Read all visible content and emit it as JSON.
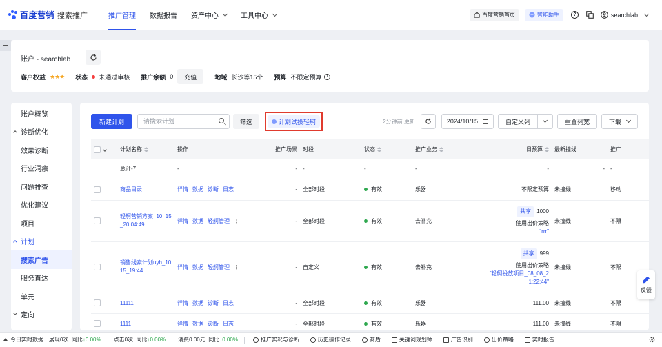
{
  "topbar": {
    "brand": "百度营销",
    "product": "搜索推广",
    "nav": [
      {
        "label": "推广管理",
        "active": true,
        "dropdown": false
      },
      {
        "label": "数据报告",
        "active": false,
        "dropdown": false
      },
      {
        "label": "资产中心",
        "active": false,
        "dropdown": true
      },
      {
        "label": "工具中心",
        "active": false,
        "dropdown": true
      }
    ],
    "home_label": "百度营销首页",
    "assistant_label": "智能助手",
    "help_icon": "question-icon",
    "copy_icon": "copy-icon",
    "username": "searchlab",
    "accent_color": "#2f54eb"
  },
  "account": {
    "title": "账户 - searchlab",
    "rating_label": "客户权益",
    "rating_stars": 3,
    "status_label": "状态",
    "status_value": "未通过审核",
    "status_color": "#f53f3f",
    "balance_label": "推广余额",
    "balance_value": "0",
    "charge_button": "充值",
    "region_label": "地域",
    "region_value": "长沙等15个",
    "budget_label": "预算",
    "budget_value": "不限定预算"
  },
  "sidebar": {
    "items": [
      {
        "label": "账户概览",
        "type": "item",
        "selected": false
      },
      {
        "label": "诊断优化",
        "type": "group",
        "open": false
      },
      {
        "label": "效果诊断",
        "type": "item",
        "selected": false
      },
      {
        "label": "行业洞察",
        "type": "item",
        "selected": false
      },
      {
        "label": "问题排查",
        "type": "item",
        "selected": false
      },
      {
        "label": "优化建议",
        "type": "item",
        "selected": false
      },
      {
        "label": "项目",
        "type": "item",
        "selected": false
      },
      {
        "label": "计划",
        "type": "group",
        "open": true
      },
      {
        "label": "搜索广告",
        "type": "item",
        "selected": true
      },
      {
        "label": "服务直达",
        "type": "item",
        "selected": false
      },
      {
        "label": "单元",
        "type": "item",
        "selected": false
      },
      {
        "label": "定向",
        "type": "group",
        "open": false
      }
    ]
  },
  "toolbar": {
    "new_plan": "新建计划",
    "search_placeholder": "请搜索计划",
    "filter": "筛选",
    "trial_boost": "计划试投轻舸",
    "updated": "2分钟前 更新",
    "date": "2024/10/15",
    "custom_columns": "自定义列",
    "reset_width": "重置列宽",
    "download": "下载"
  },
  "table": {
    "headers": [
      "计划名称",
      "操作",
      "推广场景",
      "时段",
      "状态",
      "推广业务",
      "日预算",
      "最新撞线",
      "推广"
    ],
    "total_row": {
      "name": "总计-7",
      "ops": "-",
      "scene": "-",
      "period": "-",
      "status": "-",
      "business": "-",
      "budget": "-",
      "collision": "-",
      "extra": "-"
    },
    "rows": [
      {
        "name": "商品目录",
        "ops": [
          "详情",
          "数据",
          "诊断",
          "日志"
        ],
        "more": "",
        "scene": "-",
        "period": "全部时段",
        "status": "有效",
        "business": "乐器",
        "share": "",
        "budget": "不限定预算",
        "strategy": "",
        "quote": "",
        "collision": "未撞线",
        "extra": "移动"
      },
      {
        "name": "轻舸营销方案_10_15_20:04:49",
        "ops": [
          "详情",
          "数据",
          "轻舸管理"
        ],
        "more": "⋮",
        "scene": "-",
        "period": "全部时段",
        "status": "有效",
        "business": "去补充",
        "share": "共享",
        "budget": "1000",
        "strategy": "使用出价策略",
        "quote": "\"rrr\"",
        "collision": "未撞线",
        "extra": "不限"
      },
      {
        "name": "销售线索计划uyh_1015_19:44",
        "ops": [
          "详情",
          "数据",
          "轻舸管理"
        ],
        "more": "⋮",
        "scene": "-",
        "period": "自定义",
        "status": "有效",
        "business": "去补充",
        "share": "共享",
        "budget": "999",
        "strategy": "使用出价策略",
        "quote": "\"轻舸投放项目_08_08_21:22:44\"",
        "collision": "未撞线",
        "extra": "不限"
      },
      {
        "name": "11111",
        "ops": [
          "详情",
          "数据",
          "诊断",
          "日志"
        ],
        "more": "",
        "scene": "-",
        "period": "全部时段",
        "status": "有效",
        "business": "乐器",
        "share": "",
        "budget": "111.00",
        "strategy": "",
        "quote": "",
        "collision": "未撞线",
        "extra": "不限"
      },
      {
        "name": "1111",
        "ops": [
          "详情",
          "数据",
          "诊断",
          "日志"
        ],
        "more": "",
        "scene": "-",
        "period": "全部时段",
        "status": "有效",
        "business": "乐器",
        "share": "",
        "budget": "111.00",
        "strategy": "",
        "quote": "",
        "collision": "未撞线",
        "extra": "不限"
      }
    ]
  },
  "feedback": {
    "label": "反馈"
  },
  "statusbar": {
    "today": "今日实时数据",
    "impr": "展现0次",
    "impr_cmp": "同比",
    "impr_delta": "↓0.00%",
    "click": "点击0次",
    "click_cmp": "同比",
    "click_delta": "↓0.00%",
    "cost": "消费0.00元",
    "cost_cmp": "同比",
    "cost_delta": "↓0.00%",
    "tools": [
      "推广实况与诊断",
      "历史操作记录",
      "商盾",
      "关键词规划师",
      "广告识别",
      "出价策略",
      "实时报告"
    ]
  }
}
